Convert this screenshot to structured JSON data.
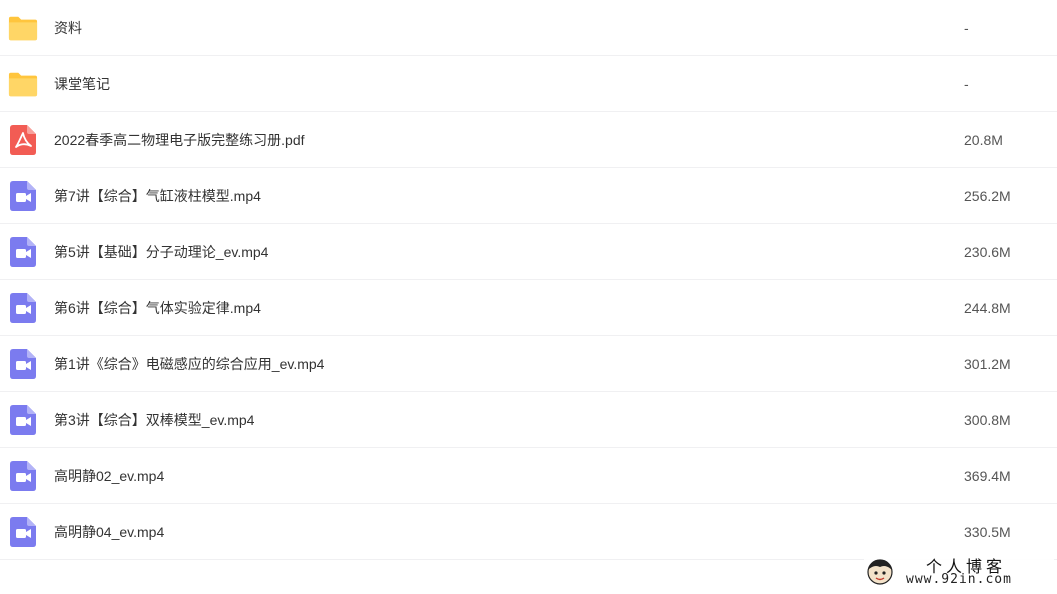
{
  "files": [
    {
      "type": "folder",
      "icon": "folder-icon",
      "name": "资料",
      "size": "-"
    },
    {
      "type": "folder",
      "icon": "folder-icon",
      "name": "课堂笔记",
      "size": "-"
    },
    {
      "type": "pdf",
      "icon": "pdf-icon",
      "name": "2022春季高二物理电子版完整练习册.pdf",
      "size": "20.8M"
    },
    {
      "type": "video",
      "icon": "video-icon",
      "name": "第7讲【综合】气缸液柱模型.mp4",
      "size": "256.2M"
    },
    {
      "type": "video",
      "icon": "video-icon",
      "name": "第5讲【基础】分子动理论_ev.mp4",
      "size": "230.6M"
    },
    {
      "type": "video",
      "icon": "video-icon",
      "name": "第6讲【综合】气体实验定律.mp4",
      "size": "244.8M"
    },
    {
      "type": "video",
      "icon": "video-icon",
      "name": "第1讲《综合》电磁感应的综合应用_ev.mp4",
      "size": "301.2M"
    },
    {
      "type": "video",
      "icon": "video-icon",
      "name": "第3讲【综合】双棒模型_ev.mp4",
      "size": "300.8M"
    },
    {
      "type": "video",
      "icon": "video-icon",
      "name": "高明静02_ev.mp4",
      "size": "369.4M"
    },
    {
      "type": "video",
      "icon": "video-icon",
      "name": "高明静04_ev.mp4",
      "size": "330.5M"
    }
  ],
  "watermark": {
    "title": "个人博客",
    "url": "www.92in.com"
  },
  "colors": {
    "folder": "#FFD666",
    "folder_tab": "#FFC53D",
    "pdf": "#F25C54",
    "video": "#7B7BEF"
  }
}
